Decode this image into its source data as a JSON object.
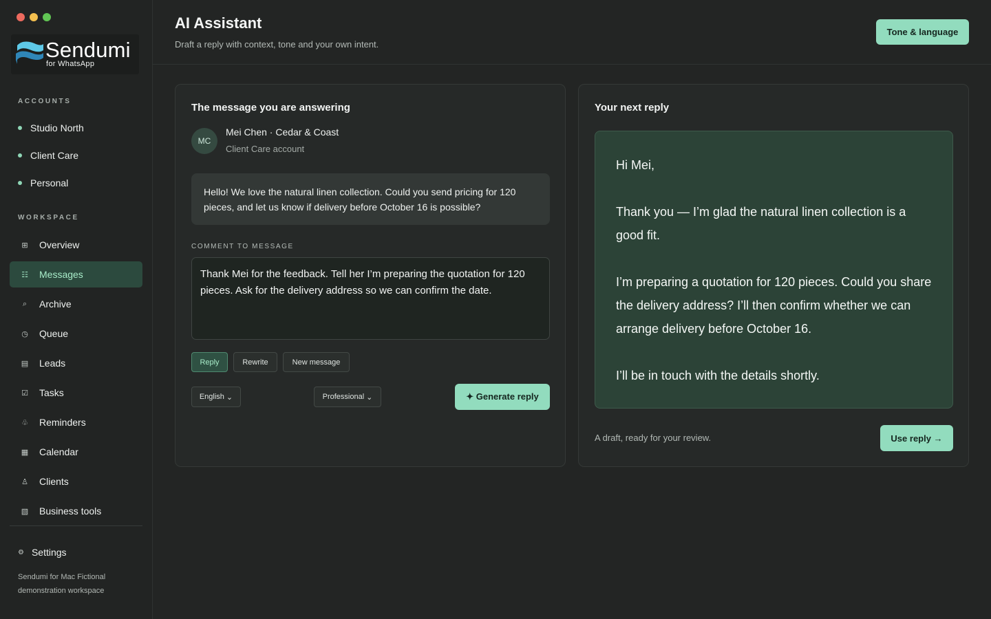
{
  "brand": {
    "name": "Sendumi",
    "tagline": "for WhatsApp",
    "logo_colors": [
      "#5ec9e8",
      "#2f86b8"
    ]
  },
  "sidebar": {
    "accounts_label": "ACCOUNTS",
    "accounts": [
      {
        "label": "Studio North"
      },
      {
        "label": "Client Care"
      },
      {
        "label": "Personal"
      }
    ],
    "workspace_label": "WORKSPACE",
    "items": [
      {
        "label": "Overview",
        "icon": "grid-icon"
      },
      {
        "label": "Messages",
        "icon": "list-icon",
        "active": true
      },
      {
        "label": "Archive",
        "icon": "search-icon"
      },
      {
        "label": "Queue",
        "icon": "clock-icon"
      },
      {
        "label": "Leads",
        "icon": "table-icon"
      },
      {
        "label": "Tasks",
        "icon": "checkbox-icon"
      },
      {
        "label": "Reminders",
        "icon": "bell-icon"
      },
      {
        "label": "Calendar",
        "icon": "calendar-icon"
      },
      {
        "label": "Clients",
        "icon": "person-icon"
      },
      {
        "label": "Business tools",
        "icon": "tools-icon"
      }
    ],
    "settings_label": "Settings",
    "footer": "Sendumi for Mac Fictional demonstration workspace"
  },
  "header": {
    "title": "AI Assistant",
    "subtitle": "Draft a reply with context, tone and your own intent.",
    "tone_button": "Tone & language"
  },
  "left_card": {
    "title": "The message you are answering",
    "sender": {
      "initials": "MC",
      "name": "Mei Chen · Cedar & Coast",
      "account": "Client Care account"
    },
    "message": "Hello! We love the natural linen collection. Could you send pricing for 120 pieces, and let us know if delivery before October 16 is possible?",
    "comment_label": "COMMENT TO MESSAGE",
    "comment": "Thank Mei for the feedback. Tell her I’m preparing the quotation for 120 pieces. Ask for the delivery address so we can confirm the date.",
    "modes": [
      "Reply",
      "Rewrite",
      "New message"
    ],
    "active_mode": "Reply",
    "language": "English",
    "tone": "Professional",
    "generate_button": "✦ Generate reply"
  },
  "right_card": {
    "title": "Your next reply",
    "reply": {
      "greeting": "Hi Mei,",
      "p1": "Thank you — I’m glad the natural linen collection is a good fit.",
      "p2": "I’m preparing a quotation for 120 pieces. Could you share the delivery address? I’ll then confirm whether we can arrange delivery before October 16.",
      "p3": "I’ll be in touch with the details shortly."
    },
    "draft_note": "A draft, ready for your review.",
    "use_button": "Use reply →"
  },
  "colors": {
    "accent": "#92dcbe",
    "active_nav_bg": "#2c4a3e",
    "reply_bg": "#2c4337",
    "background": "#232524"
  }
}
